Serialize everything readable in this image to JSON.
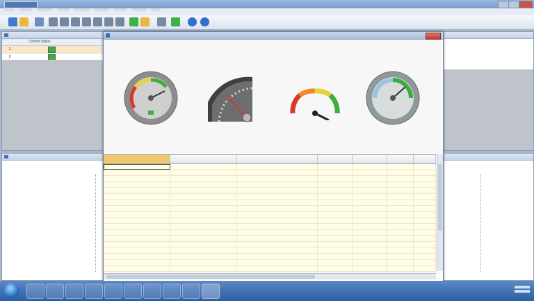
{
  "colors": {
    "window_chrome": "#9ab7df",
    "gauge_green": "#3cae3c",
    "gauge_yellow": "#e9d23a",
    "gauge_red": "#d63a2a",
    "grid_selected_header": "#f2c96a",
    "grid_background": "#fffde8",
    "close_button": "#c0392b",
    "taskbar": "#2d5ea3"
  },
  "icons": {
    "toolbar": [
      "save-icon",
      "filter-icon",
      "grid-icon",
      "first-icon",
      "prev-icon",
      "play-icon",
      "next-icon",
      "last-icon",
      "stop-icon",
      "zoom-icon",
      "add-icon",
      "help-icon",
      "settings-icon",
      "info-icon",
      "refresh-icon"
    ],
    "taskbar": [
      "start-icon",
      "explorer-icon",
      "folder-icon",
      "media-icon",
      "app-icon",
      "app-icon",
      "app-icon",
      "app-icon",
      "app-icon",
      "app-icon",
      "app-icon",
      "app-icon"
    ]
  },
  "gauges": [
    {
      "type": "round",
      "value_fraction": 0.55,
      "face": "grey"
    },
    {
      "type": "quarter",
      "value_fraction": 0.72,
      "face": "dark"
    },
    {
      "type": "semi",
      "value_fraction": 0.82,
      "face": "white"
    },
    {
      "type": "round",
      "value_fraction": 0.62,
      "face": "blue-grey"
    }
  ],
  "left_panel": {
    "column_headers": [
      "Control Status"
    ],
    "rows": [
      {
        "num": "1",
        "status": "green"
      },
      {
        "num": "2",
        "status": "green"
      }
    ]
  },
  "grid": {
    "row_count": 19
  }
}
